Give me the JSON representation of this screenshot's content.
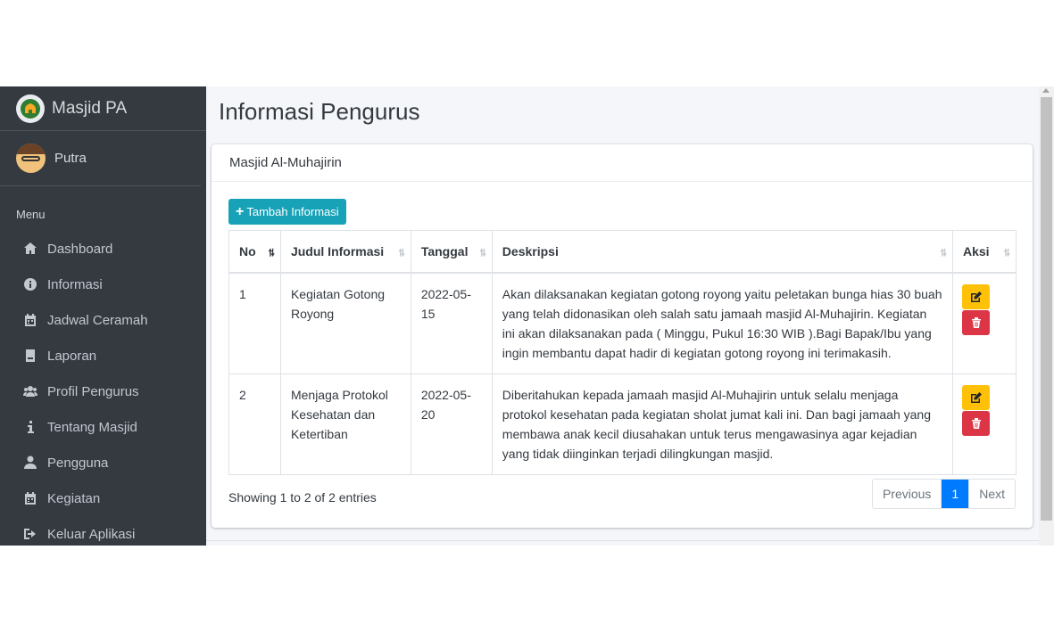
{
  "brand": {
    "name": "Masjid PA",
    "logo_icon": "mosque-logo-icon"
  },
  "user": {
    "name": "Putra",
    "avatar_icon": "user-avatar-icon"
  },
  "sidebar": {
    "header": "Menu",
    "items": [
      {
        "label": "Dashboard",
        "icon": "home-icon"
      },
      {
        "label": "Informasi",
        "icon": "info-circle-icon"
      },
      {
        "label": "Jadwal Ceramah",
        "icon": "calendar-icon"
      },
      {
        "label": "Laporan",
        "icon": "book-icon"
      },
      {
        "label": "Profil Pengurus",
        "icon": "users-icon"
      },
      {
        "label": "Tentang Masjid",
        "icon": "info-icon"
      },
      {
        "label": "Pengguna",
        "icon": "user-icon"
      },
      {
        "label": "Kegiatan",
        "icon": "calendar-icon"
      },
      {
        "label": "Keluar Aplikasi",
        "icon": "sign-out-icon"
      }
    ]
  },
  "page": {
    "title": "Informasi Pengurus"
  },
  "card": {
    "header": "Masjid Al-Muhajirin",
    "add_button": "Tambah Informasi"
  },
  "table": {
    "columns": [
      "No",
      "Judul Informasi",
      "Tanggal",
      "Deskripsi",
      "Aksi"
    ],
    "rows": [
      {
        "no": "1",
        "judul": "Kegiatan Gotong Royong",
        "tanggal": "2022-05-15",
        "deskripsi": "Akan dilaksanakan kegiatan gotong royong yaitu peletakan bunga hias 30 buah yang telah didonasikan oleh salah satu jamaah masjid Al-Muhajirin. Kegiatan ini akan dilaksanakan pada ( Minggu, Pukul 16:30 WIB ).Bagi Bapak/Ibu yang ingin membantu dapat hadir di kegiatan gotong royong ini terimakasih."
      },
      {
        "no": "2",
        "judul": "Menjaga Protokol Kesehatan dan Ketertiban",
        "tanggal": "2022-05-20",
        "deskripsi": "Diberitahukan kepada jamaah masjid Al-Muhajirin untuk selalu menjaga protokol kesehatan pada kegiatan sholat jumat kali ini. Dan bagi jamaah yang membawa anak kecil diusahakan untuk terus mengawasinya agar kejadian yang tidak diinginkan terjadi dilingkungan masjid."
      }
    ]
  },
  "footer": {
    "info": "Showing 1 to 2 of 2 entries",
    "previous": "Previous",
    "current_page": "1",
    "next": "Next"
  },
  "colors": {
    "sidebar_bg": "#343a40",
    "add_button": "#17a2b8",
    "edit_button": "#ffc107",
    "delete_button": "#dc3545",
    "active_page": "#007bff"
  }
}
